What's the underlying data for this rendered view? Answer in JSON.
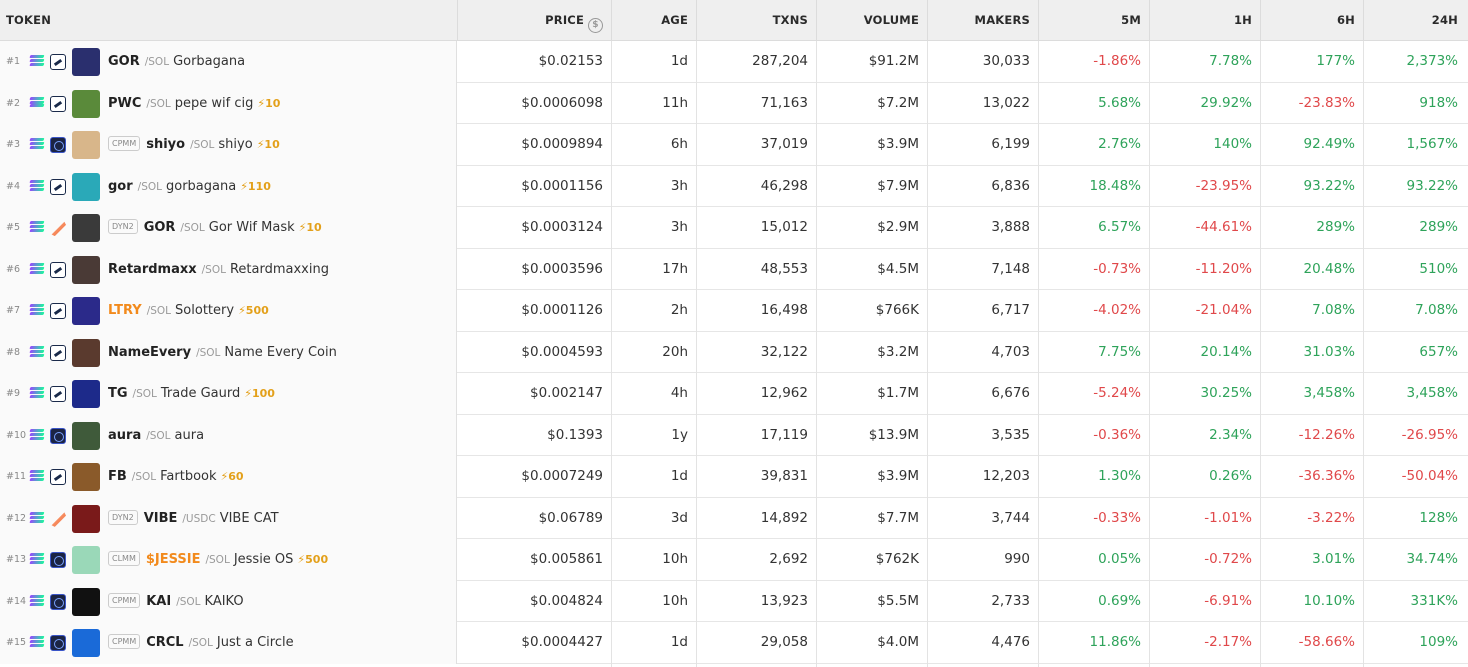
{
  "header": {
    "token": "TOKEN",
    "price": "PRICE",
    "age": "AGE",
    "txns": "TXNS",
    "volume": "VOLUME",
    "makers": "MAKERS",
    "m5": "5M",
    "h1": "1H",
    "h6": "6H",
    "h24": "24H",
    "price_icon": "$"
  },
  "colors": {
    "positive": "#2ea35a",
    "negative": "#e0484a",
    "boost": "#e3a01a"
  },
  "rows": [
    {
      "rank": "#1",
      "badge": "",
      "symbol": "GOR",
      "quote": "/SOL",
      "name": "Gorbagana",
      "boost": "",
      "price": "$0.02153",
      "age": "1d",
      "txns": "287,204",
      "volume": "$91.2M",
      "makers": "30,033",
      "m5": "-1.86%",
      "h1": "7.78%",
      "h6": "177%",
      "h24": "2,373%",
      "dex": "raydium-icon",
      "avatar": "#2a2f6e"
    },
    {
      "rank": "#2",
      "badge": "",
      "symbol": "PWC",
      "quote": "/SOL",
      "name": "pepe wif cig",
      "boost": "⚡10",
      "price": "$0.0006098",
      "age": "11h",
      "txns": "71,163",
      "volume": "$7.2M",
      "makers": "13,022",
      "m5": "5.68%",
      "h1": "29.92%",
      "h6": "-23.83%",
      "h24": "918%",
      "dex": "raydium-icon",
      "avatar": "#5a8a3a"
    },
    {
      "rank": "#3",
      "badge": "CPMM",
      "symbol": "shiyo",
      "quote": "/SOL",
      "name": "shiyo",
      "boost": "⚡10",
      "price": "$0.0009894",
      "age": "6h",
      "txns": "37,019",
      "volume": "$3.9M",
      "makers": "6,199",
      "m5": "2.76%",
      "h1": "140%",
      "h6": "92.49%",
      "h24": "1,567%",
      "dex": "pump-icon",
      "avatar": "#d8b68a"
    },
    {
      "rank": "#4",
      "badge": "",
      "symbol": "gor",
      "quote": "/SOL",
      "name": "gorbagana",
      "boost": "⚡110",
      "price": "$0.0001156",
      "age": "3h",
      "txns": "46,298",
      "volume": "$7.9M",
      "makers": "6,836",
      "m5": "18.48%",
      "h1": "-23.95%",
      "h6": "93.22%",
      "h24": "93.22%",
      "dex": "raydium-icon",
      "avatar": "#2aa9b8"
    },
    {
      "rank": "#5",
      "badge": "DYN2",
      "symbol": "GOR",
      "quote": "/SOL",
      "name": "Gor Wif Mask",
      "boost": "⚡10",
      "price": "$0.0003124",
      "age": "3h",
      "txns": "15,012",
      "volume": "$2.9M",
      "makers": "3,888",
      "m5": "6.57%",
      "h1": "-44.61%",
      "h6": "289%",
      "h24": "289%",
      "dex": "meteora-icon",
      "avatar": "#3a3a3a"
    },
    {
      "rank": "#6",
      "badge": "",
      "symbol": "Retardmaxx",
      "quote": "/SOL",
      "name": "Retardmaxxing",
      "boost": "",
      "price": "$0.0003596",
      "age": "17h",
      "txns": "48,553",
      "volume": "$4.5M",
      "makers": "7,148",
      "m5": "-0.73%",
      "h1": "-11.20%",
      "h6": "20.48%",
      "h24": "510%",
      "dex": "raydium-icon",
      "avatar": "#4a3a36"
    },
    {
      "rank": "#7",
      "badge": "",
      "symbol": "LTRY",
      "quote": "/SOL",
      "name": "Solottery",
      "boost": "⚡500",
      "price": "$0.0001126",
      "age": "2h",
      "txns": "16,498",
      "volume": "$766K",
      "makers": "6,717",
      "m5": "-4.02%",
      "h1": "-21.04%",
      "h6": "7.08%",
      "h24": "7.08%",
      "dex": "raydium-icon",
      "avatar": "#2b2a8a",
      "orange": true
    },
    {
      "rank": "#8",
      "badge": "",
      "symbol": "NameEvery",
      "quote": "/SOL",
      "name": "Name Every Coin",
      "boost": "",
      "price": "$0.0004593",
      "age": "20h",
      "txns": "32,122",
      "volume": "$3.2M",
      "makers": "4,703",
      "m5": "7.75%",
      "h1": "20.14%",
      "h6": "31.03%",
      "h24": "657%",
      "dex": "raydium-icon",
      "avatar": "#5a3a2e"
    },
    {
      "rank": "#9",
      "badge": "",
      "symbol": "TG",
      "quote": "/SOL",
      "name": "Trade Gaurd",
      "boost": "⚡100",
      "price": "$0.002147",
      "age": "4h",
      "txns": "12,962",
      "volume": "$1.7M",
      "makers": "6,676",
      "m5": "-5.24%",
      "h1": "30.25%",
      "h6": "3,458%",
      "h24": "3,458%",
      "dex": "raydium-icon",
      "avatar": "#1d2a8a"
    },
    {
      "rank": "#10",
      "badge": "",
      "symbol": "aura",
      "quote": "/SOL",
      "name": "aura",
      "boost": "",
      "price": "$0.1393",
      "age": "1y",
      "txns": "17,119",
      "volume": "$13.9M",
      "makers": "3,535",
      "m5": "-0.36%",
      "h1": "2.34%",
      "h6": "-12.26%",
      "h24": "-26.95%",
      "dex": "pump-icon",
      "avatar": "#3f5a3a"
    },
    {
      "rank": "#11",
      "badge": "",
      "symbol": "FB",
      "quote": "/SOL",
      "name": "Fartbook",
      "boost": "⚡60",
      "price": "$0.0007249",
      "age": "1d",
      "txns": "39,831",
      "volume": "$3.9M",
      "makers": "12,203",
      "m5": "1.30%",
      "h1": "0.26%",
      "h6": "-36.36%",
      "h24": "-50.04%",
      "dex": "raydium-icon",
      "avatar": "#8a5a2a"
    },
    {
      "rank": "#12",
      "badge": "DYN2",
      "symbol": "VIBE",
      "quote": "/USDC",
      "name": "VIBE CAT",
      "boost": "",
      "price": "$0.06789",
      "age": "3d",
      "txns": "14,892",
      "volume": "$7.7M",
      "makers": "3,744",
      "m5": "-0.33%",
      "h1": "-1.01%",
      "h6": "-3.22%",
      "h24": "128%",
      "dex": "meteora-icon",
      "avatar": "#7a1a1a"
    },
    {
      "rank": "#13",
      "badge": "CLMM",
      "symbol": "$JESSIE",
      "quote": "/SOL",
      "name": "Jessie OS",
      "boost": "⚡500",
      "price": "$0.005861",
      "age": "10h",
      "txns": "2,692",
      "volume": "$762K",
      "makers": "990",
      "m5": "0.05%",
      "h1": "-0.72%",
      "h6": "3.01%",
      "h24": "34.74%",
      "dex": "pump-icon",
      "avatar": "#9ad8b8",
      "orange": true
    },
    {
      "rank": "#14",
      "badge": "CPMM",
      "symbol": "KAI",
      "quote": "/SOL",
      "name": "KAIKO",
      "boost": "",
      "price": "$0.004824",
      "age": "10h",
      "txns": "13,923",
      "volume": "$5.5M",
      "makers": "2,733",
      "m5": "0.69%",
      "h1": "-6.91%",
      "h6": "10.10%",
      "h24": "331K%",
      "dex": "pump-icon",
      "avatar": "#111111"
    },
    {
      "rank": "#15",
      "badge": "CPMM",
      "symbol": "CRCL",
      "quote": "/SOL",
      "name": "Just a Circle",
      "boost": "",
      "price": "$0.0004427",
      "age": "1d",
      "txns": "29,058",
      "volume": "$4.0M",
      "makers": "4,476",
      "m5": "11.86%",
      "h1": "-2.17%",
      "h6": "-58.66%",
      "h24": "109%",
      "dex": "pump-icon",
      "avatar": "#1a6ad8"
    }
  ]
}
